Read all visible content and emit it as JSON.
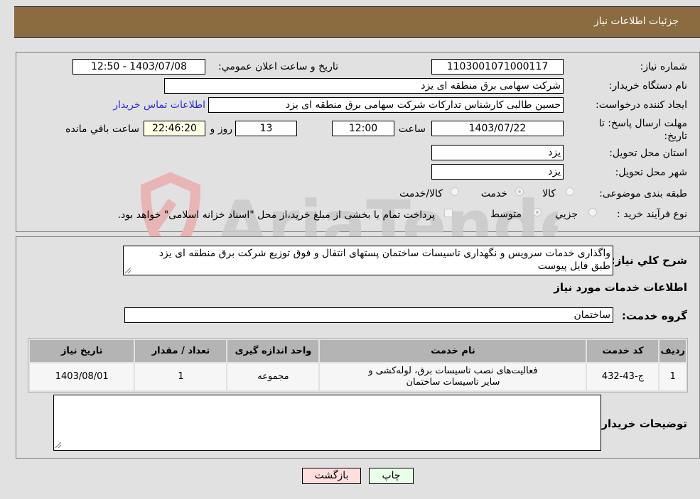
{
  "header": {
    "title": "جزئیات اطلاعات نیاز"
  },
  "form": {
    "need_number": {
      "label": "شماره نیاز:",
      "value": "1103001071000117"
    },
    "announce_datetime": {
      "label": "تاریخ و ساعت اعلان عمومي:",
      "value": "1403/07/08 - 12:50"
    },
    "buyer_org": {
      "label": "نام دستگاه خریدار:",
      "value": "شرکت سهامی برق منطقه ای یزد"
    },
    "requester": {
      "label": "ایجاد کننده درخواست:",
      "value": "حسین طالبی کارشناس تدارکات شرکت سهامی برق منطقه ای یزد",
      "contact_link": "اطلاعات تماس خریدار"
    },
    "deadline": {
      "label": "مهلت ارسال پاسخ: تا تاریخ:",
      "date": "1403/07/22",
      "time_label": "ساعت",
      "time": "12:00",
      "days": "13",
      "days_label": "روز و",
      "remaining": "22:46:20",
      "remaining_label": "ساعت باقي مانده"
    },
    "province": {
      "label": "استان محل تحویل:",
      "value": "یزد"
    },
    "city": {
      "label": "شهر محل تحویل:",
      "value": "یزد"
    },
    "category": {
      "label": "طبقه بندی موضوعی:",
      "options": [
        {
          "label": "کالا",
          "checked": false
        },
        {
          "label": "خدمت",
          "checked": true
        },
        {
          "label": "کالا/خدمت",
          "checked": false
        }
      ]
    },
    "purchase_type": {
      "label": "نوع فرآیند خرید :",
      "options": [
        {
          "label": "جزيي",
          "checked": false
        },
        {
          "label": "متوسط",
          "checked": true
        }
      ],
      "treasury_note": "پرداخت تمام یا بخشی از مبلغ خرید،از محل \"اسناد خزانه اسلامی\" خواهد بود.",
      "treasury_checked": false
    }
  },
  "description": {
    "label": "شرح کلي نیاز:",
    "value_line1": "واگذاری خدمات سرویس و نگهداری تاسیسات ساختمان پستهای انتقال و فوق توزیع شرکت برق منطقه ای یزد",
    "value_line2": "طبق فایل پیوست"
  },
  "services": {
    "section_title": "اطلاعات خدمات مورد نیاز",
    "group_label": "گروه خدمت:",
    "group_value": "ساختمان",
    "table": {
      "headers": [
        "ردیف",
        "کد خدمت",
        "نام خدمت",
        "واحد اندازه گیری",
        "تعداد / مقدار",
        "تاریخ نیاز"
      ],
      "rows": [
        [
          "1",
          "ج-43-432",
          "فعالیت‌های نصب تاسیسات برق، لوله‌کشی و سایر تاسیسات ساختمان",
          "مجموعه",
          "1",
          "1403/08/01"
        ]
      ]
    },
    "buyer_notes_label": "توضیحات خریدار:",
    "buyer_notes_value": ""
  },
  "buttons": {
    "print": "چاپ",
    "back": "بازگشت"
  },
  "watermark": {
    "text": "AriaTender.neT"
  },
  "colors": {
    "header_bg": "#8b6b40",
    "print_bg": "#eaffea",
    "back_bg": "#ffdede",
    "link": "#2a2ad8"
  }
}
